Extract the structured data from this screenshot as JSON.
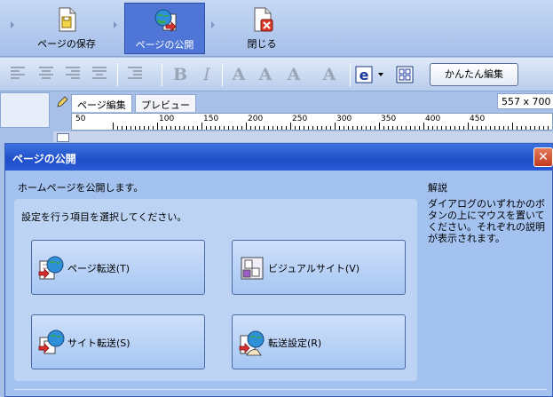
{
  "toolbar": {
    "save_label": "ページの保存",
    "publish_label": "ページの公開",
    "close_label": "閉じる"
  },
  "format_toolbar": {
    "easy_edit_label": "かんたん編集"
  },
  "editor": {
    "tab_edit": "ページ編集",
    "tab_preview": "プレビュー",
    "size": "557 x 700",
    "ruler_labels": [
      "50",
      "50",
      "100",
      "150",
      "200",
      "250",
      "300",
      "350",
      "400",
      "450"
    ]
  },
  "dialog": {
    "title": "ページの公開",
    "intro": "ホームページを公開します。",
    "instruction": "設定を行う項目を選択してください。",
    "buttons": {
      "page_transfer": "ページ転送(T)",
      "visual_site": "ビジュアルサイト(V)",
      "site_transfer": "サイト転送(S)",
      "transfer_settings": "転送設定(R)"
    },
    "help_heading": "解説",
    "help_text": "ダイアログのいずれかのボタンの上にマウスを置いてください。それぞれの説明が表示されます。"
  },
  "icons": {
    "save": "save-page-icon",
    "publish": "publish-globe-icon",
    "close": "close-document-icon"
  },
  "colors": {
    "accent": "#4f75d6",
    "dialog_title": "#1f4fc9",
    "close_button": "#c13a1c"
  }
}
